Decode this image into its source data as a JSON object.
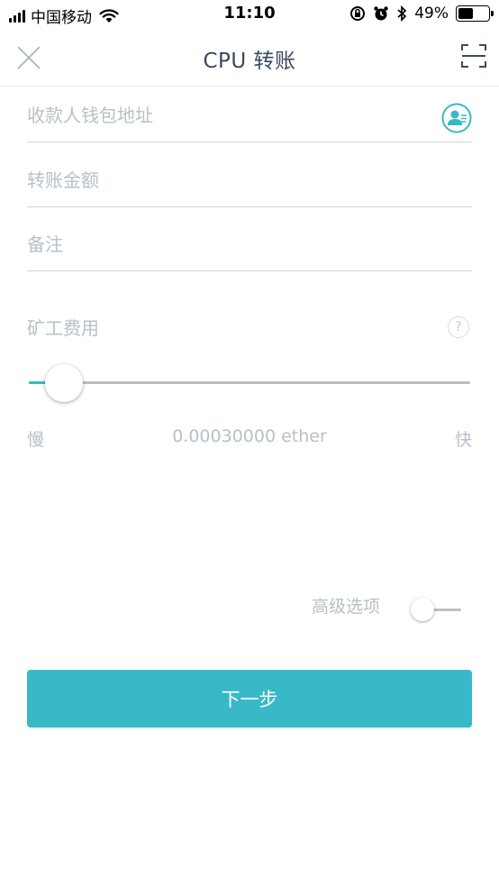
{
  "status_bar": {
    "carrier": "中国移动",
    "time": "11:10",
    "battery": "49%",
    "battery_level": 0.49
  },
  "nav": {
    "title": "CPU 转账"
  },
  "form": {
    "address_placeholder": "收款人钱包地址",
    "amount_placeholder": "转账金额",
    "memo_placeholder": "备注"
  },
  "fee": {
    "label": "矿工费用",
    "help": "?",
    "slow_label": "慢",
    "fast_label": "快",
    "value": "0.00030000 ether",
    "slider_level": 0.08
  },
  "advanced": {
    "label": "高级选项",
    "enabled": false
  },
  "next_button": {
    "label": "下一步"
  },
  "colors": {
    "accent": "#38b9c7",
    "placeholder": "#b7c0c9",
    "title": "#3a4a5e",
    "divider": "#cfd4d9"
  },
  "icons": {
    "close": "close-icon",
    "scan": "scan-icon",
    "contact": "contact-book-icon",
    "help": "question-icon"
  }
}
